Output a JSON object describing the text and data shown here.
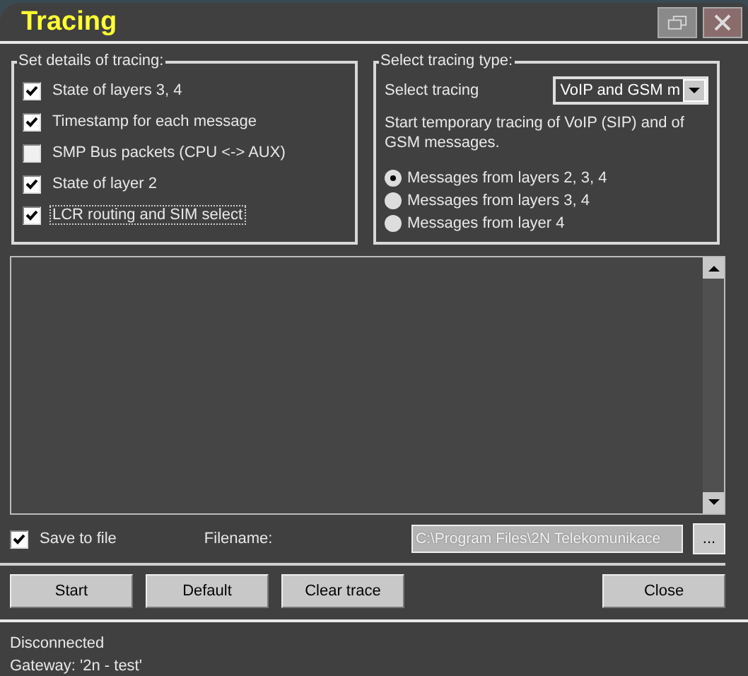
{
  "window": {
    "title": "Tracing"
  },
  "details": {
    "legend": "Set details of tracing:",
    "options": [
      {
        "label": "State of layers 3, 4",
        "checked": true,
        "focused": false
      },
      {
        "label": "Timestamp for each message",
        "checked": true,
        "focused": false
      },
      {
        "label": "SMP Bus packets (CPU <-> AUX)",
        "checked": false,
        "focused": false
      },
      {
        "label": "State of layer 2",
        "checked": true,
        "focused": false
      },
      {
        "label": "LCR routing and SIM select",
        "checked": true,
        "focused": true
      }
    ]
  },
  "tracing_type": {
    "legend": "Select tracing type:",
    "select_label": "Select tracing",
    "select_value": "VoIP and GSM m",
    "description": "Start temporary tracing of VoIP (SIP) and of GSM messages.",
    "options": [
      {
        "label": "Messages from layers 2, 3, 4",
        "selected": true
      },
      {
        "label": "Messages from layers 3, 4",
        "selected": false
      },
      {
        "label": "Messages from layer 4",
        "selected": false
      }
    ]
  },
  "save": {
    "label": "Save to file",
    "checked": true
  },
  "filename": {
    "label": "Filename:",
    "value": "C:\\Program Files\\2N Telekomunikace",
    "disabled": true
  },
  "browse_button": "...",
  "buttons": [
    "Start",
    "Default",
    "Clear trace",
    "Close"
  ],
  "status": [
    "Disconnected",
    "Gateway: '2n - test'"
  ]
}
